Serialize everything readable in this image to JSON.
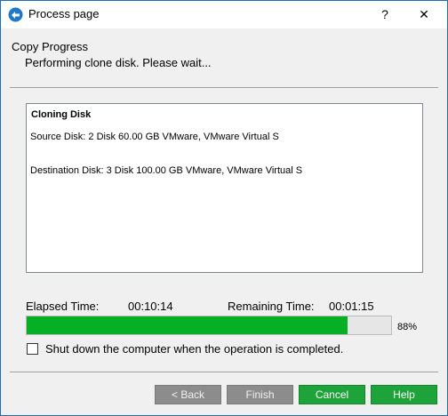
{
  "window": {
    "title": "Process page",
    "help_glyph": "?",
    "close_glyph": "✕",
    "icon": "app-logo-icon"
  },
  "header": {
    "heading": "Copy Progress",
    "subheading": "Performing clone disk. Please wait..."
  },
  "log": {
    "title": "Cloning Disk",
    "lines": [
      "Source Disk: 2 Disk 60.00 GB VMware, VMware Virtual S",
      "Destination Disk: 3 Disk 100.00 GB VMware, VMware Virtual S"
    ]
  },
  "timing": {
    "elapsed_label": "Elapsed Time:",
    "elapsed_value": "00:10:14",
    "remaining_label": "Remaining Time:",
    "remaining_value": "00:01:15"
  },
  "progress": {
    "percent": 88,
    "percent_label": "88%",
    "fill_color": "#06b025"
  },
  "options": {
    "shutdown_label": "Shut down the computer when the operation is completed.",
    "shutdown_checked": false
  },
  "buttons": {
    "back": "< Back",
    "finish": "Finish",
    "cancel": "Cancel",
    "help": "Help"
  },
  "colors": {
    "accent_green": "#1ea23a",
    "disabled_gray": "#8c8c8c",
    "window_border": "#1e6fb8"
  }
}
